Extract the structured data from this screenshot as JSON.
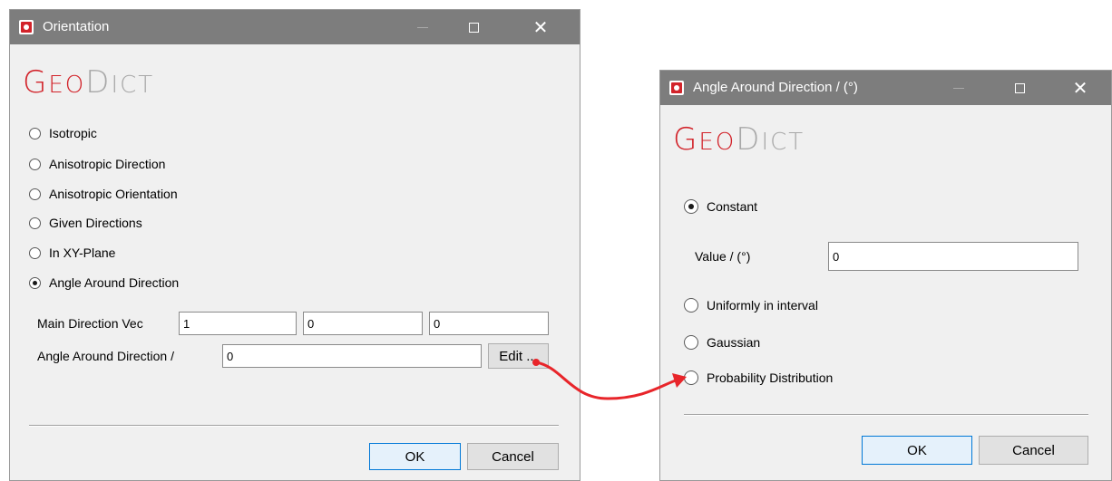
{
  "colors": {
    "titlebar": "#7d7d7d",
    "dialog_bg": "#f0f0f0",
    "brand_red": "#d2232a",
    "brand_gray": "#a8a8a8",
    "arrow": "#e8252a"
  },
  "orientation_dialog": {
    "title": "Orientation",
    "logo": {
      "geo_first": "G",
      "geo_rest": "EO",
      "dict_first": "D",
      "dict_rest": "ICT"
    },
    "options": [
      {
        "label": "Isotropic",
        "checked": false
      },
      {
        "label": "Anisotropic Direction",
        "checked": false
      },
      {
        "label": "Anisotropic Orientation",
        "checked": false
      },
      {
        "label": "Given Directions",
        "checked": false
      },
      {
        "label": "In XY-Plane",
        "checked": false
      },
      {
        "label": "Angle Around Direction",
        "checked": true
      }
    ],
    "main_direction": {
      "label": "Main Direction Vec",
      "values": [
        "1",
        "0",
        "0"
      ]
    },
    "angle": {
      "label": "Angle Around Direction /",
      "value": "0",
      "edit_label": "Edit ..."
    },
    "ok_label": "OK",
    "cancel_label": "Cancel"
  },
  "angle_dialog": {
    "title": "Angle Around Direction / (°)",
    "logo": {
      "geo_first": "G",
      "geo_rest": "EO",
      "dict_first": "D",
      "dict_rest": "ICT"
    },
    "options": [
      {
        "label": "Constant",
        "checked": true
      },
      {
        "label": "Uniformly in interval",
        "checked": false
      },
      {
        "label": "Gaussian",
        "checked": false
      },
      {
        "label": "Probability Distribution",
        "checked": false
      }
    ],
    "value": {
      "label": "Value / (°)",
      "value": "0"
    },
    "ok_label": "OK",
    "cancel_label": "Cancel"
  }
}
